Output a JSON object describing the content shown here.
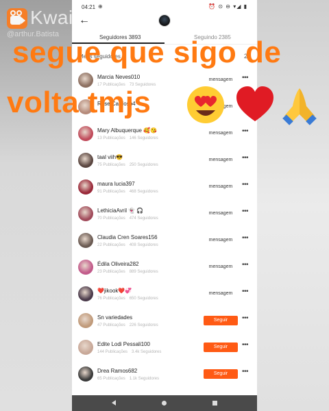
{
  "watermark": {
    "brand": "Kwai",
    "handle": "@arthur.Batista"
  },
  "status_bar": {
    "time": "04:21",
    "left_icon": "⊕",
    "right_icons": "⏰ ⊙ ⊖ ▾◢ ▮"
  },
  "top_bar": {
    "back_icon": "arrow-left-icon",
    "avatar": "profile-avatar"
  },
  "tabs": {
    "followers": "Seguidores 3893",
    "following": "Seguindo 2385"
  },
  "section": {
    "header": "Meus seguidores",
    "right": "2"
  },
  "followers": [
    {
      "name": "Marcia Neves010",
      "posts": "17 Publicações",
      "followers": "73 Seguidores",
      "action": "mensagem",
      "action_type": "msg",
      "avatar_color": "#8c6f60"
    },
    {
      "name": "Rose Cardoso4",
      "posts": "",
      "followers": "",
      "action": "mensagem",
      "action_type": "msg",
      "avatar_color": "#b58a7a"
    },
    {
      "name": "Mary Albuquerque 🥰😘",
      "posts": "13 Publicações",
      "followers": "146 Seguidores",
      "action": "mensagem",
      "action_type": "msg",
      "avatar_color": "#c04a5a"
    },
    {
      "name": "taal viih😎",
      "posts": "75 Publicações",
      "followers": "250 Seguidores",
      "action": "mensagem",
      "action_type": "msg",
      "avatar_color": "#5a4640"
    },
    {
      "name": "maura lucia397",
      "posts": "91 Publicações",
      "followers": "468 Seguidores",
      "action": "mensagem",
      "action_type": "msg",
      "avatar_color": "#9a2a3a"
    },
    {
      "name": "LethiciaAvril 👻 🎧",
      "posts": "70 Publicações",
      "followers": "474 Seguidores",
      "action": "mensagem",
      "action_type": "msg",
      "avatar_color": "#a04a5a"
    },
    {
      "name": "Claudia Cren Soares156",
      "posts": "22 Publicações",
      "followers": "408 Seguidores",
      "action": "mensagem",
      "action_type": "msg",
      "avatar_color": "#6a5a52"
    },
    {
      "name": "Édila Oliveira282",
      "posts": "23 Publicações",
      "followers": "889 Seguidores",
      "action": "mensagem",
      "action_type": "msg",
      "avatar_color": "#c25a8a"
    },
    {
      "name": "❤️jikook❤️💞",
      "posts": "76 Publicações",
      "followers": "650 Seguidores",
      "action": "mensagem",
      "action_type": "msg",
      "avatar_color": "#4a3a4a"
    },
    {
      "name": "Sn variedades",
      "posts": "47 Publicações",
      "followers": "226 Seguidores",
      "action": "Seguir",
      "action_type": "follow",
      "avatar_color": "#c09a7a"
    },
    {
      "name": "Edite Lodi Pessali100",
      "posts": "144 Publicações",
      "followers": "3.4k Seguidores",
      "action": "Seguir",
      "action_type": "follow",
      "avatar_color": "#c8a898"
    },
    {
      "name": "Drea Ramos682",
      "posts": "65 Publicações",
      "followers": "1.1k Seguidores",
      "action": "Seguir",
      "action_type": "follow",
      "avatar_color": "#3a3a3a"
    }
  ],
  "caption": {
    "line1": "segue que sigo de",
    "line2": "volta tmjs"
  },
  "colors": {
    "accent": "#ff5a14",
    "caption": "#ff7a12"
  }
}
